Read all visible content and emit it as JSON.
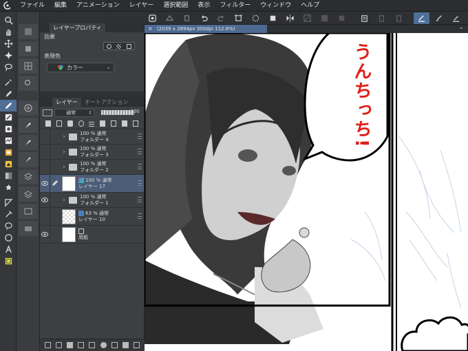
{
  "menu": {
    "items": [
      "ファイル",
      "編集",
      "アニメーション",
      "レイヤー",
      "選択範囲",
      "表示",
      "フィルター",
      "ウィンドウ",
      "ヘルプ"
    ]
  },
  "property_panel": {
    "tab_label": "レイヤープロパティ",
    "effect_label": "効果",
    "color_label": "表現色",
    "color_value": "カラー"
  },
  "layer_panel": {
    "tab_layer": "レイヤー",
    "tab_auto": "オートアクション",
    "blend_mode": "通常",
    "opacity": "100",
    "layers": [
      {
        "mode": "100 %  通常",
        "name": "フォルダー 4",
        "type": "folder",
        "visible": false,
        "selected": false
      },
      {
        "mode": "100 %  通常",
        "name": "フォルダー 3",
        "type": "folder",
        "visible": false,
        "selected": false
      },
      {
        "mode": "100 %  通常",
        "name": "フォルダー 2",
        "type": "folder",
        "visible": false,
        "selected": false
      },
      {
        "mode": "100 %  通常",
        "name": "レイヤー 17",
        "type": "raster",
        "visible": true,
        "selected": true
      },
      {
        "mode": "100 %  通常",
        "name": "フォルダー 1",
        "type": "folder",
        "visible": true,
        "selected": false
      },
      {
        "mode": "63 %  通常",
        "name": "レイヤー 10",
        "type": "raster",
        "visible": false,
        "selected": false
      },
      {
        "mode": "",
        "name": "用紙",
        "type": "paper",
        "visible": true,
        "selected": false
      }
    ]
  },
  "document": {
    "tab_title": "(2039 x 2894px 300dpi 112.6%)"
  },
  "canvas": {
    "speech_text": "うんちっち!",
    "speech_color": "#e0201c"
  },
  "colors": {
    "accent": "#4f6f97",
    "selected_layer": "#4b5d77",
    "panel": "#3d4043"
  }
}
